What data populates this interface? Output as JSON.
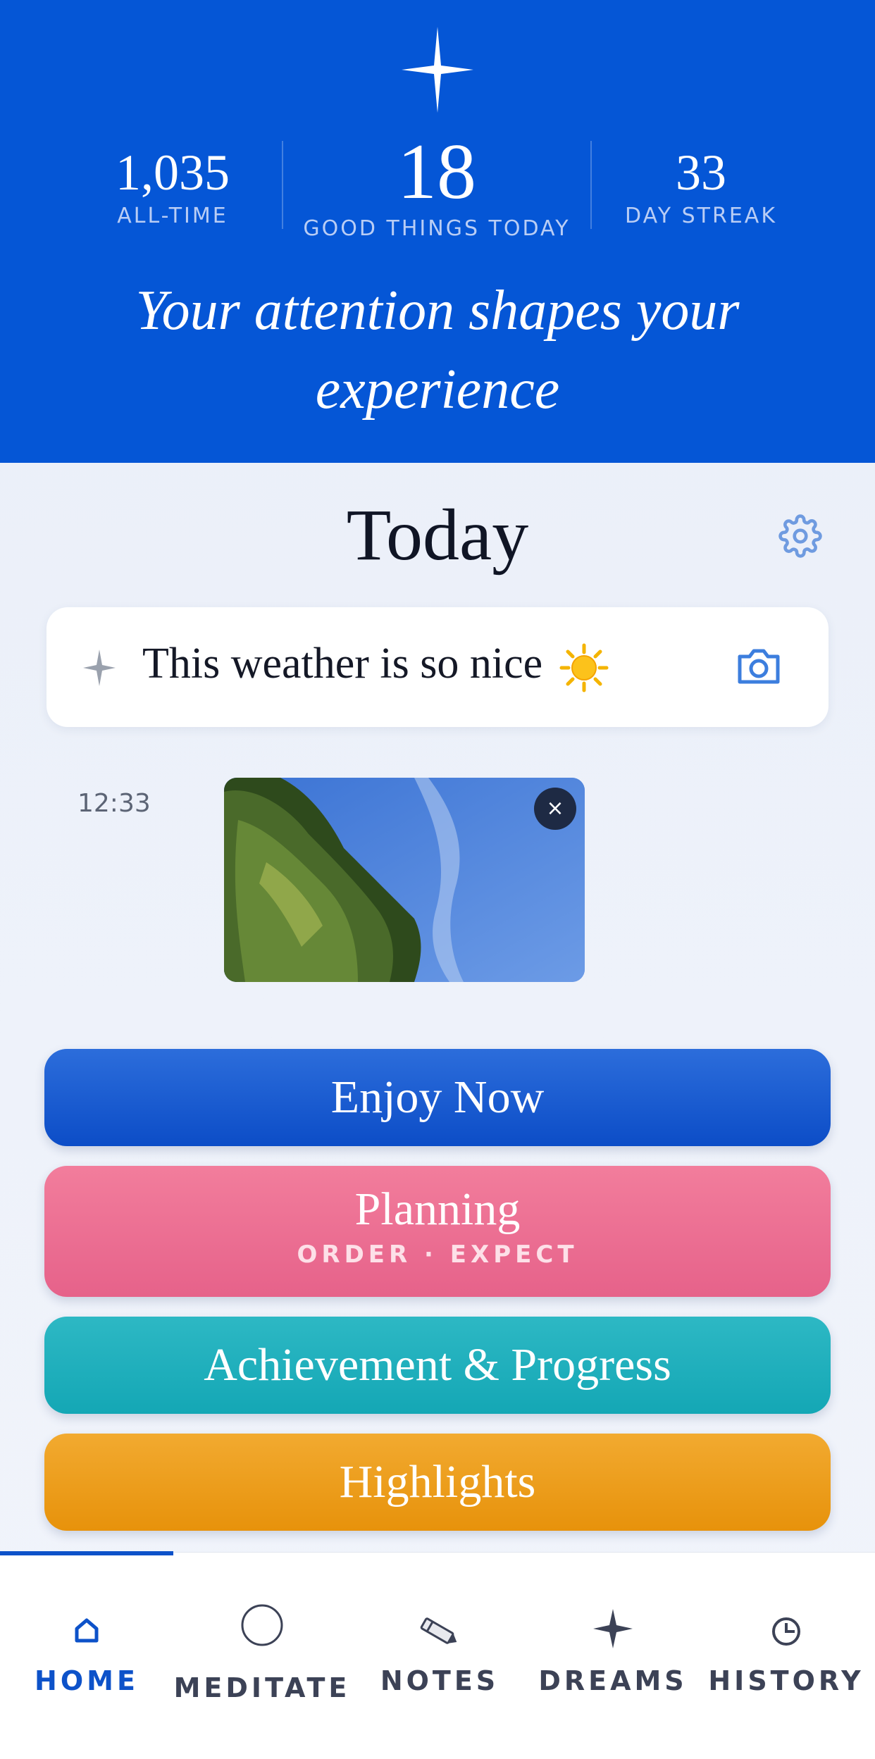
{
  "header": {
    "stats": {
      "all_time": {
        "value": "1,035",
        "label": "ALL-TIME"
      },
      "today": {
        "value": "18",
        "label": "GOOD THINGS TODAY"
      },
      "streak": {
        "value": "33",
        "label": "DAY STREAK"
      }
    },
    "tagline": "Your attention shapes your experience",
    "icon": "sparkle-star-icon"
  },
  "today": {
    "title": "Today",
    "settings_icon": "gear-icon"
  },
  "entry": {
    "text": "This weather is so nice",
    "emoji": "sun-emoji",
    "camera_icon": "camera-icon",
    "spark_icon": "sparkle-icon"
  },
  "log": {
    "time": "12:33",
    "photo_alt": "tree against blue sky",
    "remove_label": "×"
  },
  "categories": [
    {
      "label": "Enjoy Now",
      "color": "#1a5fd4"
    },
    {
      "label": "Planning",
      "sub": "ORDER · EXPECT",
      "color": "#ec6f92"
    },
    {
      "label": "Achievement & Progress",
      "color": "#1eaebb"
    },
    {
      "label": "Highlights",
      "color": "#ec9e1c"
    }
  ],
  "tabs": [
    {
      "label": "HOME",
      "icon": "home-icon",
      "active": true
    },
    {
      "label": "MEDITATE",
      "icon": "circle-icon"
    },
    {
      "label": "NOTES",
      "icon": "pencil-icon"
    },
    {
      "label": "DREAMS",
      "icon": "sparkle-icon"
    },
    {
      "label": "HISTORY",
      "icon": "clock-icon"
    }
  ],
  "colors": {
    "primary": "#0556d6",
    "background": "#e9eef8",
    "active_tab": "#0d52c9"
  }
}
